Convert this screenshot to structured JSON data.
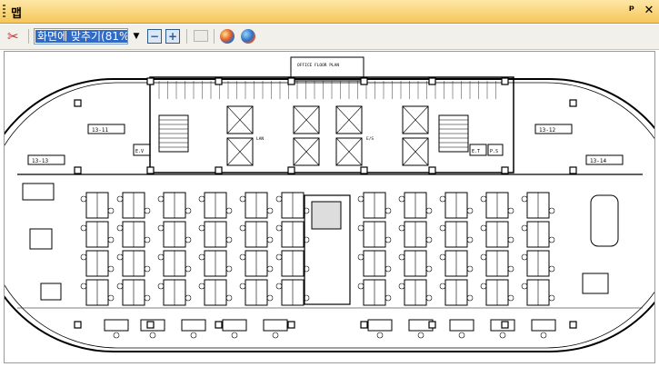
{
  "window": {
    "title": "맵"
  },
  "toolbar": {
    "zoom_value": "화면에 맞추기(81%)",
    "zoom_out": "−",
    "zoom_in": "+"
  },
  "floorplan": {
    "room_tags": [
      "13-11",
      "13-12",
      "13-13",
      "13-14"
    ],
    "labels": [
      "E.V",
      "LAN",
      "E/S",
      "E.T",
      "P.S"
    ],
    "header_note": "OFFICE FLOOR PLAN",
    "icons": [
      "tools-icon",
      "zoom-out-icon",
      "zoom-in-icon",
      "folder-icon",
      "globe-icon",
      "globe-alt-icon"
    ]
  },
  "colors": {
    "title_gradient": "#f6c65a",
    "selection": "#316ac5",
    "plan_line": "#000000"
  }
}
